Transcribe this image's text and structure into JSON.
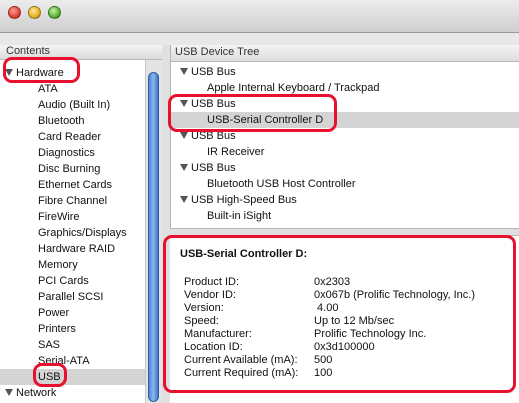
{
  "window": {
    "close": "close",
    "minimize": "minimize",
    "zoom": "zoom"
  },
  "sidebar": {
    "header": "Contents",
    "hardware_label": "Hardware",
    "items": [
      "ATA",
      "Audio (Built In)",
      "Bluetooth",
      "Card Reader",
      "Diagnostics",
      "Disc Burning",
      "Ethernet Cards",
      "Fibre Channel",
      "FireWire",
      "Graphics/Displays",
      "Hardware RAID",
      "Memory",
      "PCI Cards",
      "Parallel SCSI",
      "Power",
      "Printers",
      "SAS",
      "Serial-ATA",
      "USB"
    ],
    "network_label": "Network",
    "selected": "USB"
  },
  "tree": {
    "header": "USB Device Tree",
    "rows": [
      {
        "kind": "bus",
        "label": "USB Bus"
      },
      {
        "kind": "dev",
        "label": "Apple Internal Keyboard / Trackpad"
      },
      {
        "kind": "bus",
        "label": "USB Bus"
      },
      {
        "kind": "dev",
        "label": "USB-Serial Controller D"
      },
      {
        "kind": "bus",
        "label": "USB Bus"
      },
      {
        "kind": "dev",
        "label": "IR Receiver"
      },
      {
        "kind": "bus",
        "label": "USB Bus"
      },
      {
        "kind": "dev",
        "label": "Bluetooth USB Host Controller"
      },
      {
        "kind": "bus",
        "label": "USB High-Speed Bus"
      },
      {
        "kind": "dev",
        "label": "Built-in iSight"
      }
    ],
    "selected_index": 3
  },
  "details": {
    "title": "USB-Serial Controller D:",
    "rows": [
      {
        "key": "Product ID:",
        "value": "0x2303"
      },
      {
        "key": "Vendor ID:",
        "value": "0x067b  (Prolific Technology, Inc.)"
      },
      {
        "key": "Version:",
        "value": " 4.00"
      },
      {
        "key": "Speed:",
        "value": "Up to 12 Mb/sec"
      },
      {
        "key": "Manufacturer:",
        "value": "Prolific Technology Inc."
      },
      {
        "key": "Location ID:",
        "value": "0x3d100000"
      },
      {
        "key": "Current Available (mA):",
        "value": "500"
      },
      {
        "key": "Current Required (mA):",
        "value": "100"
      }
    ]
  },
  "colors": {
    "highlight": "#e8112d",
    "selection": "#d4d4d4",
    "scroll_thumb": "#5a8fdc"
  }
}
